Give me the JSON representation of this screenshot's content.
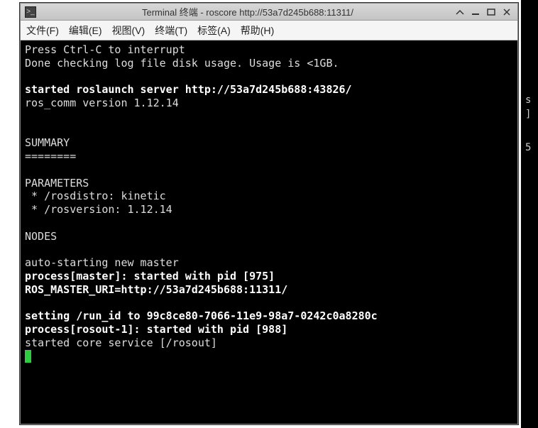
{
  "window": {
    "title": "Terminal 终端 - roscore http://53a7d245b688:11311/",
    "icon_glyph": ">_"
  },
  "menu": {
    "file": "文件(F)",
    "edit": "编辑(E)",
    "view": "视图(V)",
    "terminal": "终端(T)",
    "tabs": "标签(A)",
    "help": "帮助(H)"
  },
  "term": {
    "l1": "Press Ctrl-C to interrupt",
    "l2": "Done checking log file disk usage. Usage is <1GB.",
    "blank": "",
    "l3": "started roslaunch server http://53a7d245b688:43826/",
    "l4": "ros_comm version 1.12.14",
    "l5": "SUMMARY",
    "l6": "========",
    "l7": "PARAMETERS",
    "l8": " * /rosdistro: kinetic",
    "l9": " * /rosversion: 1.12.14",
    "l10": "NODES",
    "l11": "auto-starting new master",
    "l12": "process[master]: started with pid [975]",
    "l13": "ROS_MASTER_URI=http://53a7d245b688:11311/",
    "l14": "setting /run_id to 99c8ce80-7066-11e9-98a7-0242c0a8280c",
    "l15": "process[rosout-1]: started with pid [988]",
    "l16": "started core service [/rosout]"
  },
  "strip": {
    "a": "s",
    "b": "]",
    "c": "5"
  }
}
